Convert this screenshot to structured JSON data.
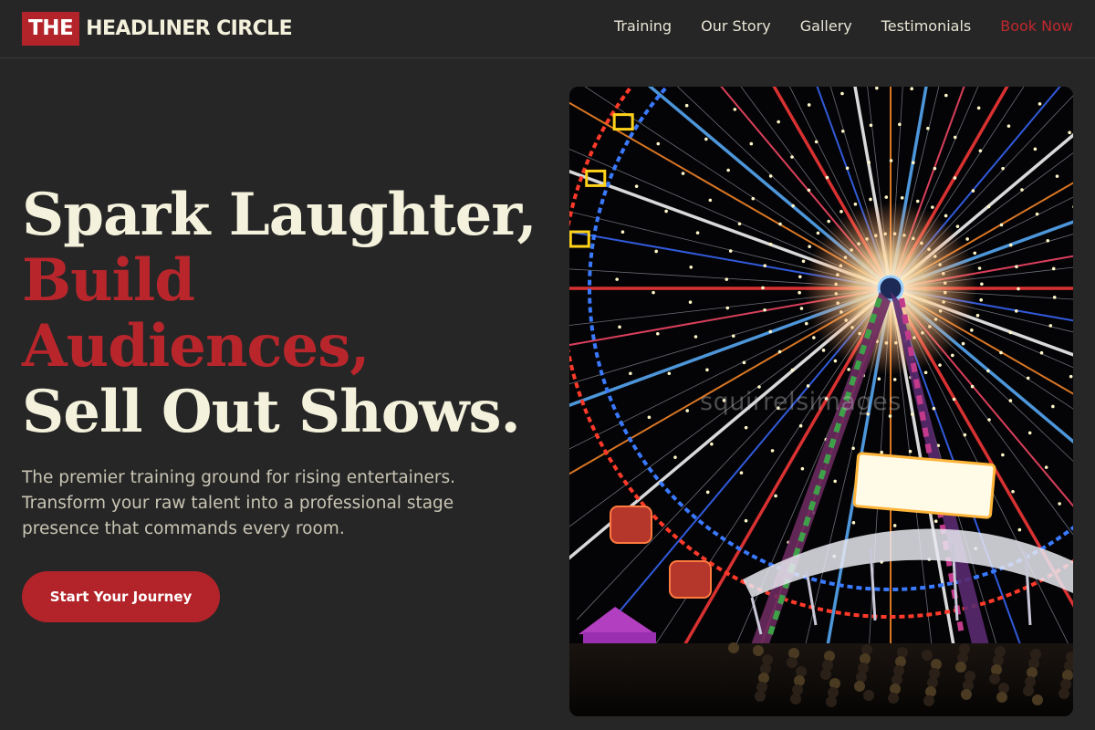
{
  "header": {
    "logo_badge": "THE",
    "logo_text": "HEADLINER CIRCLE",
    "nav": [
      {
        "label": "Training"
      },
      {
        "label": "Our Story"
      },
      {
        "label": "Gallery"
      },
      {
        "label": "Testimonials"
      },
      {
        "label": "Book Now"
      }
    ]
  },
  "hero": {
    "title_line1": "Spark Laughter,",
    "title_line2": "Build",
    "title_line3": "Audiences,",
    "title_line4": "Sell Out Shows.",
    "subtitle": "The premier training ground for rising entertainers. Transform your raw talent into a professional stage presence that commands every room.",
    "cta_label": "Start Your Journey"
  },
  "image": {
    "watermark": "squirrelsimages",
    "subject": "illuminated ferris wheel at night"
  },
  "colors": {
    "background": "#262626",
    "accent": "#b3242a",
    "cream": "#f4f1dc"
  }
}
